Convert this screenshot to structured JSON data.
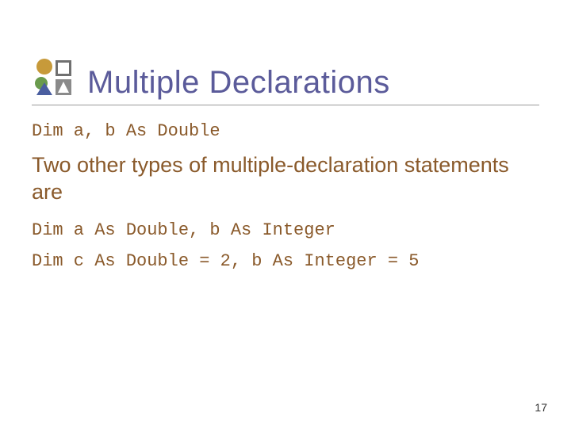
{
  "slide": {
    "title": "Multiple Declarations",
    "code1": "Dim a, b As Double",
    "paragraph": "Two other types of multiple-declaration statements are",
    "code2_line1": "Dim a As Double, b As Integer",
    "code2_line2": "Dim c As Double = 2, b As Integer = 5",
    "page_number": "17"
  }
}
